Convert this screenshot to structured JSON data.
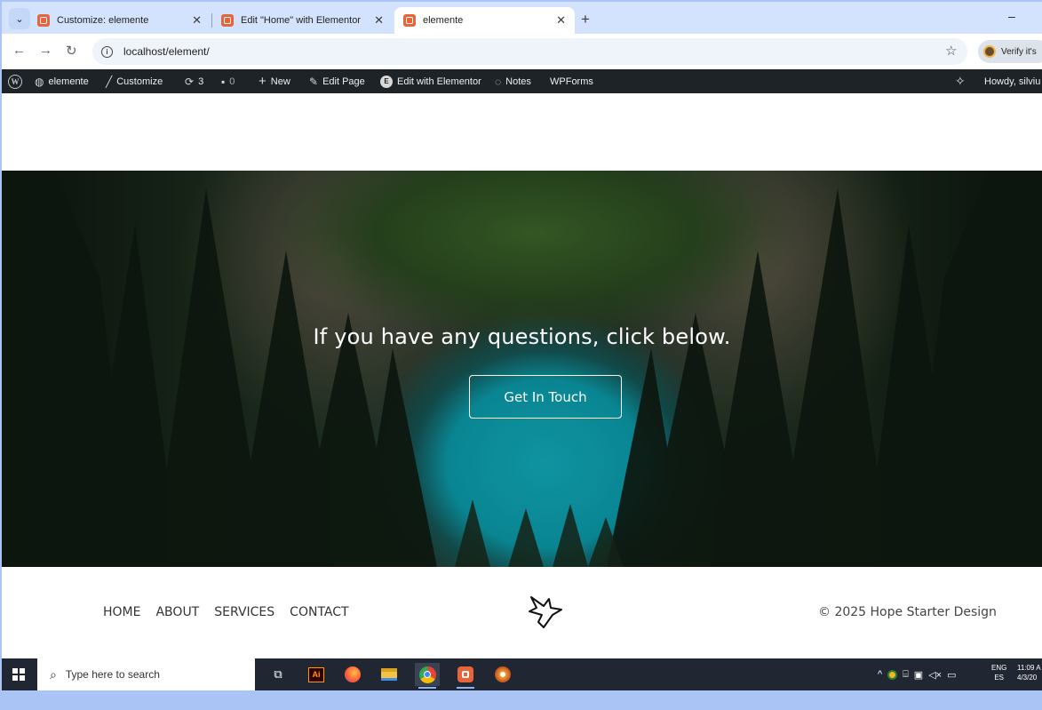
{
  "browser": {
    "tabs": [
      {
        "label": "Customize: elemente",
        "active": false
      },
      {
        "label": "Edit \"Home\" with Elementor",
        "active": false
      },
      {
        "label": "elemente",
        "active": true
      }
    ],
    "close_glyph": "✕",
    "new_tab_glyph": "+",
    "minimize_glyph": "–",
    "url": "localhost/element/",
    "profile_label": "Verify it's"
  },
  "admin_bar": {
    "site_name": "elemente",
    "customize": "Customize",
    "updates_count": "3",
    "comments_count": "0",
    "new": "New",
    "edit_page": "Edit Page",
    "edit_with_elementor": "Edit with Elementor",
    "notes": "Notes",
    "wpforms": "WPForms",
    "howdy": "Howdy, silviu"
  },
  "hero": {
    "heading": "If you have any questions, click below.",
    "cta_label": "Get In Touch"
  },
  "footer": {
    "nav": [
      "HOME",
      "ABOUT",
      "SERVICES",
      "CONTACT"
    ],
    "copyright": "© 2025 Hope Starter Design"
  },
  "taskbar": {
    "search_placeholder": "Type here to search",
    "lang_line1": "ENG",
    "lang_line2": "ES",
    "time": "11:09 A",
    "date": "4/3/20",
    "apps": [
      "task-view-icon",
      "illustrator-icon",
      "firefox-icon",
      "file-explorer-icon",
      "chrome-icon",
      "elementor-app-icon",
      "misc-app-icon"
    ]
  },
  "colors": {
    "admin_bar_bg": "#1d2327",
    "lake": "#14b4c4",
    "taskbar_bg": "#202733",
    "tab_strip_bg": "#d3e3fd"
  }
}
